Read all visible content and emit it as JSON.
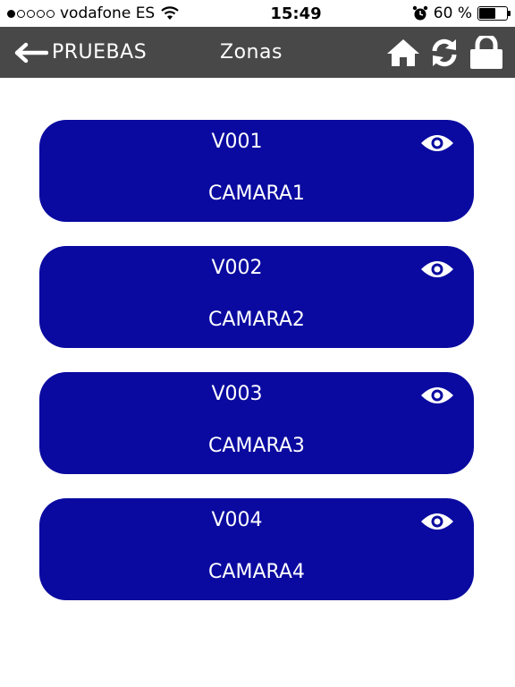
{
  "status": {
    "carrier": "vodafone ES",
    "time": "15:49",
    "battery_text": "60 %",
    "battery_level": 0.6
  },
  "nav": {
    "back_label": "PRUEBAS",
    "title": "Zonas"
  },
  "zones": [
    {
      "code": "V001",
      "name": "CAMARA1"
    },
    {
      "code": "V002",
      "name": "CAMARA2"
    },
    {
      "code": "V003",
      "name": "CAMARA3"
    },
    {
      "code": "V004",
      "name": "CAMARA4"
    }
  ],
  "colors": {
    "nav_bg": "#484848",
    "card_bg": "#0a0aa0",
    "text": "#ffffff"
  },
  "icons": [
    "back-arrow-icon",
    "home-icon",
    "refresh-icon",
    "lock-icon",
    "eye-icon"
  ]
}
